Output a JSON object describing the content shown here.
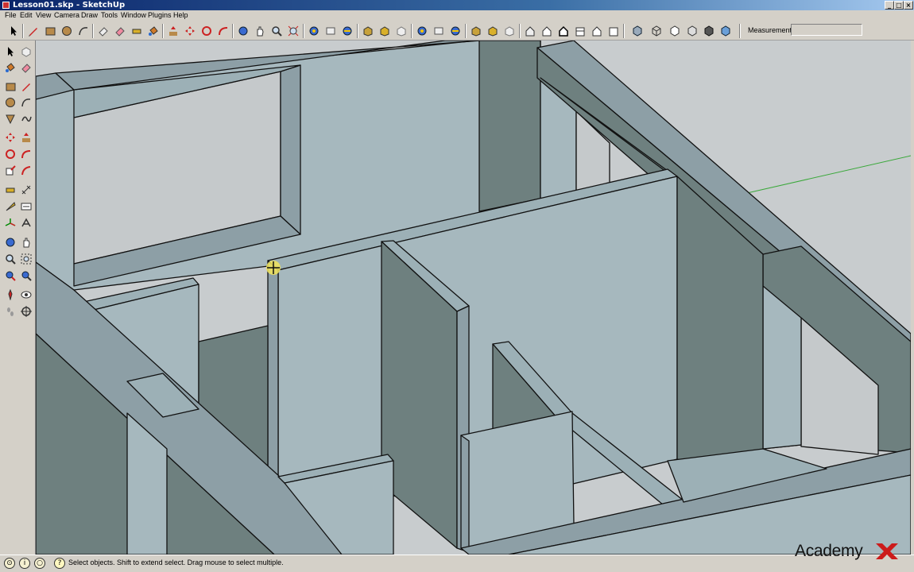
{
  "window": {
    "title": "Lesson01.skp - SketchUp"
  },
  "menu": [
    "File",
    "Edit",
    "View",
    "Camera",
    "Draw",
    "Tools",
    "Window",
    "Plugins",
    "Help"
  ],
  "toolbar": {
    "icons": [
      "select-icon",
      "eraser-icon",
      "pencil-icon",
      "rectangle-icon",
      "circle-icon",
      "arc-icon",
      "polygon-icon",
      "eraser-icon",
      "tape-measure-icon",
      "paint-bucket-icon",
      "push-pull-icon",
      "move-icon",
      "rotate-icon",
      "follow-me-icon",
      "orbit-icon",
      "pan-icon",
      "zoom-icon",
      "zoom-extents-icon",
      "camera-icon",
      "camera-icon",
      "camera-icon",
      "box-icon",
      "box-icon",
      "box-icon",
      "camera-icon",
      "camera-icon",
      "camera-icon",
      "box-icon",
      "box-icon",
      "box-icon",
      "house-icon",
      "house-icon",
      "house-icon",
      "house-icon",
      "house-icon",
      "house-icon",
      "cube-icon",
      "cube-icon",
      "cube-icon",
      "cube-icon",
      "cube-icon",
      "cube-icon"
    ],
    "measurements_label": "Measurements",
    "measurements_value": ""
  },
  "left_toolbar": {
    "icons": [
      "select-icon",
      "component-icon",
      "paint-bucket-icon",
      "eraser-icon",
      "rectangle-icon",
      "line-icon",
      "circle-icon",
      "arc-icon",
      "polygon-icon",
      "freehand-icon",
      "move-icon",
      "push-pull-icon",
      "rotate-icon",
      "follow-me-icon",
      "scale-icon",
      "offset-icon",
      "tape-measure-icon",
      "dimension-icon",
      "protractor-icon",
      "text-icon",
      "axes-icon",
      "3d-text-icon",
      "orbit-icon",
      "pan-icon",
      "zoom-icon",
      "zoom-window-icon",
      "zoom-extents-icon",
      "previous-view-icon",
      "position-camera-icon",
      "look-around-icon",
      "walk-icon",
      "section-plane-icon"
    ]
  },
  "status": {
    "text": "Select objects. Shift to extend select. Drag mouse to select multiple."
  },
  "watermark": {
    "text": "Academy"
  },
  "colors": {
    "sky": "#c8ccce",
    "wall_light": "#a4b8bf",
    "wall_mid": "#8d9fa6",
    "wall_dark": "#6e807f",
    "edge": "#111111",
    "titlebar": "#0a246a"
  }
}
